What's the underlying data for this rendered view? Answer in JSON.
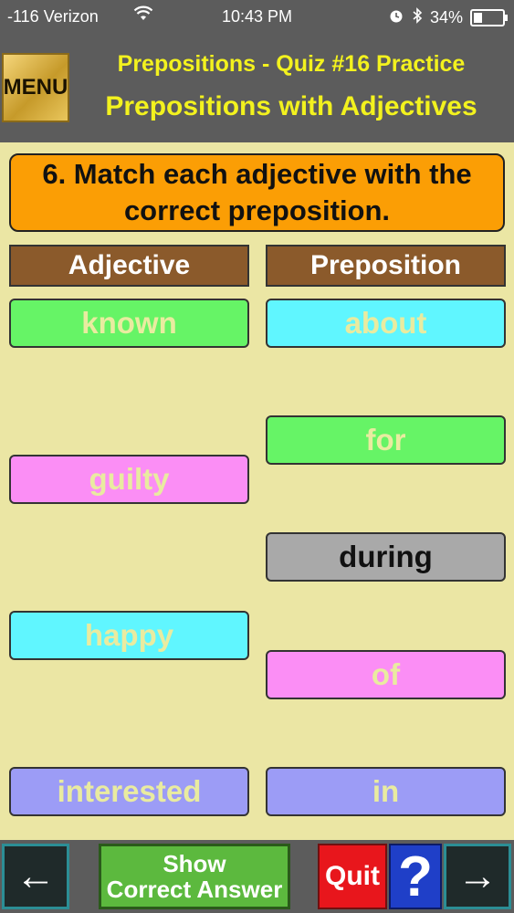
{
  "status_bar": {
    "carrier": "-116 Verizon",
    "time": "10:43 PM",
    "battery": "34%",
    "battery_level": 0.34
  },
  "header": {
    "menu_label": "MENU",
    "title": "Prepositions - Quiz #16 Practice",
    "subtitle": "Prepositions with Adjectives"
  },
  "question": "6. Match each adjective with the correct preposition.",
  "columns": {
    "adjective_header": "Adjective",
    "preposition_header": "Preposition"
  },
  "adjectives": [
    {
      "label": "known",
      "color": "#66f466"
    },
    {
      "label": "guilty",
      "color": "#fb8ef5"
    },
    {
      "label": "happy",
      "color": "#60f6ff"
    },
    {
      "label": "interested",
      "color": "#9c9cf6"
    }
  ],
  "prepositions": [
    {
      "label": "about",
      "color": "#60f6ff"
    },
    {
      "label": "for",
      "color": "#66f466"
    },
    {
      "label": "during",
      "color": "#a9a9a9",
      "text_color": "#111111"
    },
    {
      "label": "of",
      "color": "#fb8ef5"
    },
    {
      "label": "in",
      "color": "#9c9cf6"
    }
  ],
  "bottom_bar": {
    "back_icon": "←",
    "show_answer_line1": "Show",
    "show_answer_line2": "Correct Answer",
    "quit_label": "Quit",
    "help_icon": "?",
    "next_icon": "→"
  }
}
